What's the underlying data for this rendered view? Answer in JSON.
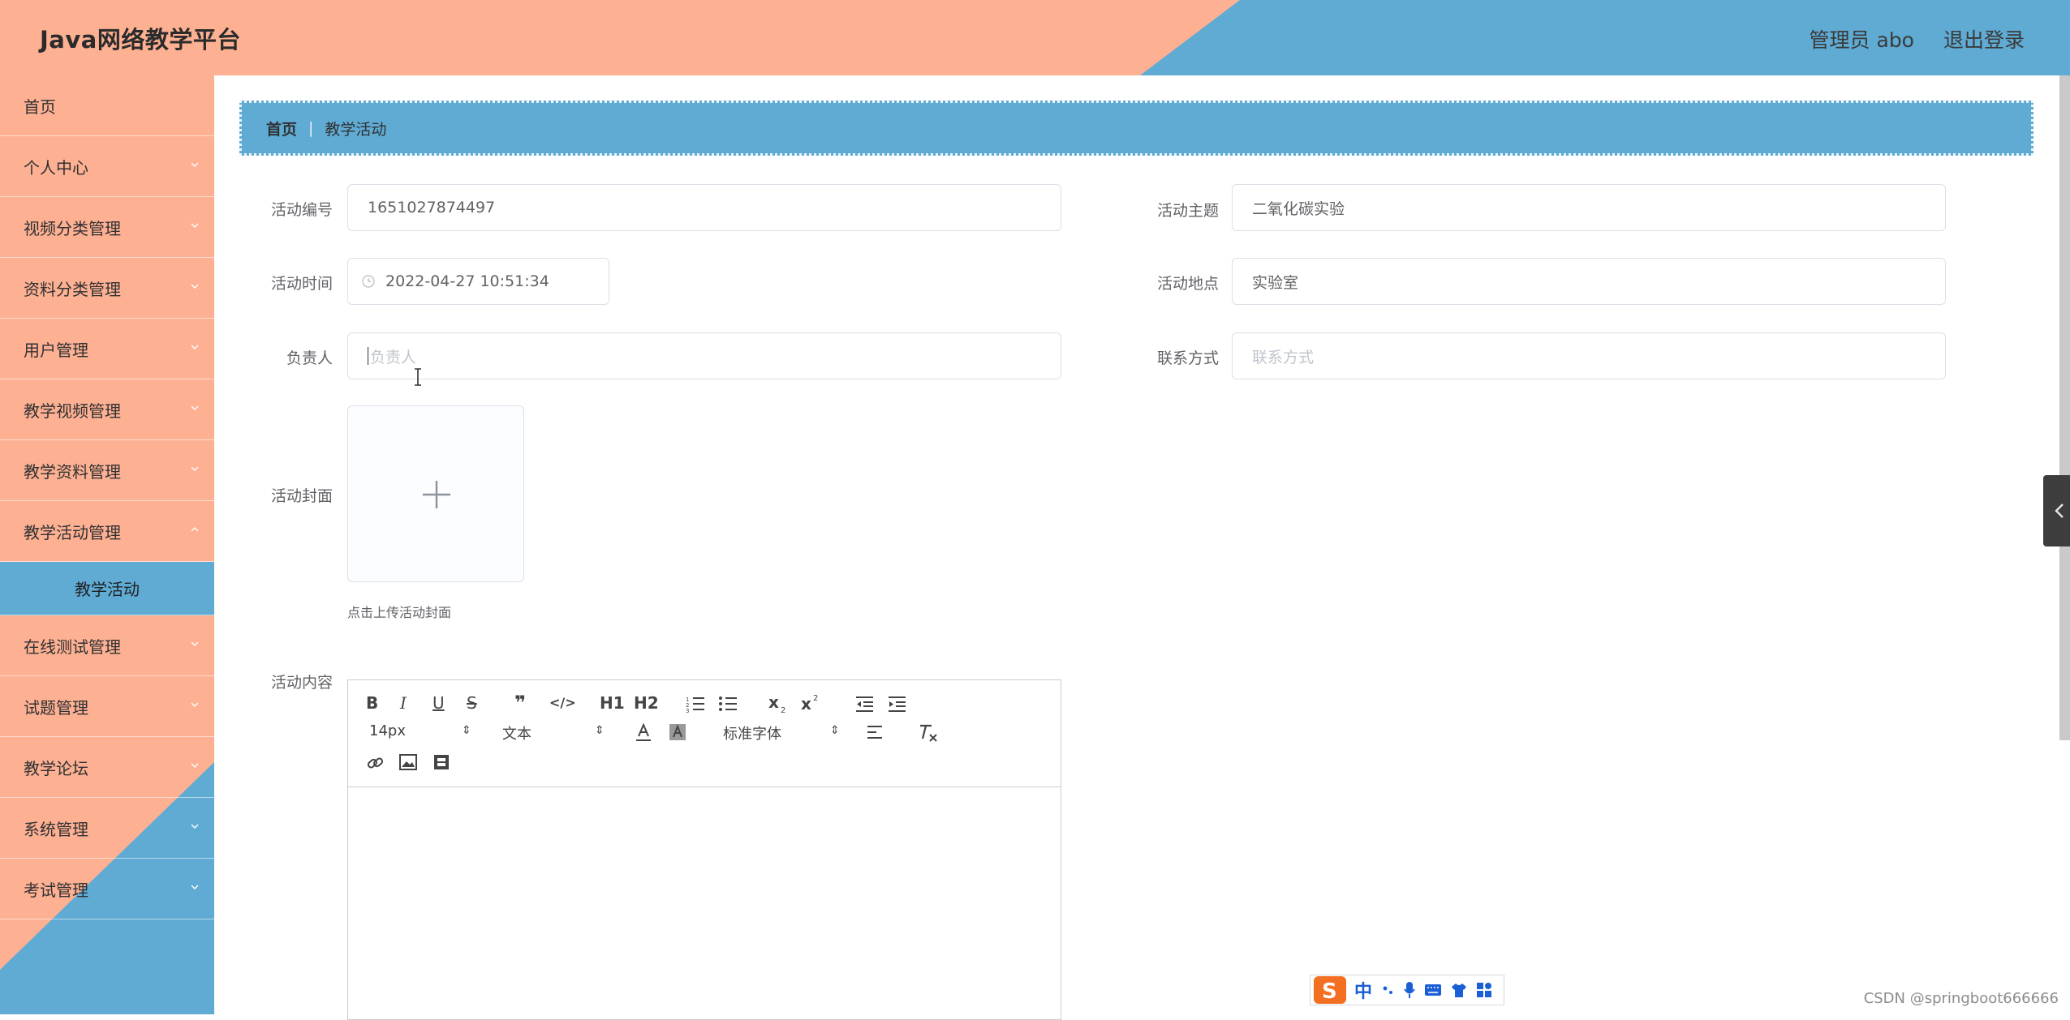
{
  "header": {
    "title": "Java网络教学平台",
    "user_label": "管理员 abo",
    "logout_label": "退出登录",
    "colors": {
      "salmon": "#fdb092",
      "blue": "#5fabd3"
    }
  },
  "sidebar": {
    "items": [
      {
        "label": "首页",
        "has_submenu": false
      },
      {
        "label": "个人中心",
        "has_submenu": true
      },
      {
        "label": "视频分类管理",
        "has_submenu": true
      },
      {
        "label": "资料分类管理",
        "has_submenu": true
      },
      {
        "label": "用户管理",
        "has_submenu": true
      },
      {
        "label": "教学视频管理",
        "has_submenu": true
      },
      {
        "label": "教学资料管理",
        "has_submenu": true
      },
      {
        "label": "教学活动管理",
        "has_submenu": true,
        "expanded": true
      },
      {
        "label": "在线测试管理",
        "has_submenu": true
      },
      {
        "label": "试题管理",
        "has_submenu": true
      },
      {
        "label": "教学论坛",
        "has_submenu": true
      },
      {
        "label": "系统管理",
        "has_submenu": true
      },
      {
        "label": "考试管理",
        "has_submenu": true
      }
    ],
    "active_sub": "教学活动"
  },
  "breadcrumb": {
    "home": "首页",
    "current": "教学活动"
  },
  "form": {
    "activity_no": {
      "label": "活动编号",
      "value": "1651027874497"
    },
    "topic": {
      "label": "活动主题",
      "value": "二氧化碳实验"
    },
    "time": {
      "label": "活动时间",
      "value": "2022-04-27 10:51:34"
    },
    "location": {
      "label": "活动地点",
      "value": "实验室"
    },
    "leader": {
      "label": "负责人",
      "placeholder": "负责人"
    },
    "contact": {
      "label": "联系方式",
      "placeholder": "联系方式"
    },
    "cover": {
      "label": "活动封面",
      "hint": "点击上传活动封面"
    },
    "content": {
      "label": "活动内容"
    }
  },
  "editor": {
    "font_size": "14px",
    "header_select": "文本",
    "font_family": "标准字体",
    "heading1": "H1",
    "heading2": "H2",
    "buttons": {
      "bold": "B",
      "italic": "I",
      "underline": "U",
      "strike": "S",
      "quote": "❞",
      "code": "</>"
    }
  },
  "ime": {
    "mode": "中"
  },
  "watermark": "CSDN @springboot666666"
}
